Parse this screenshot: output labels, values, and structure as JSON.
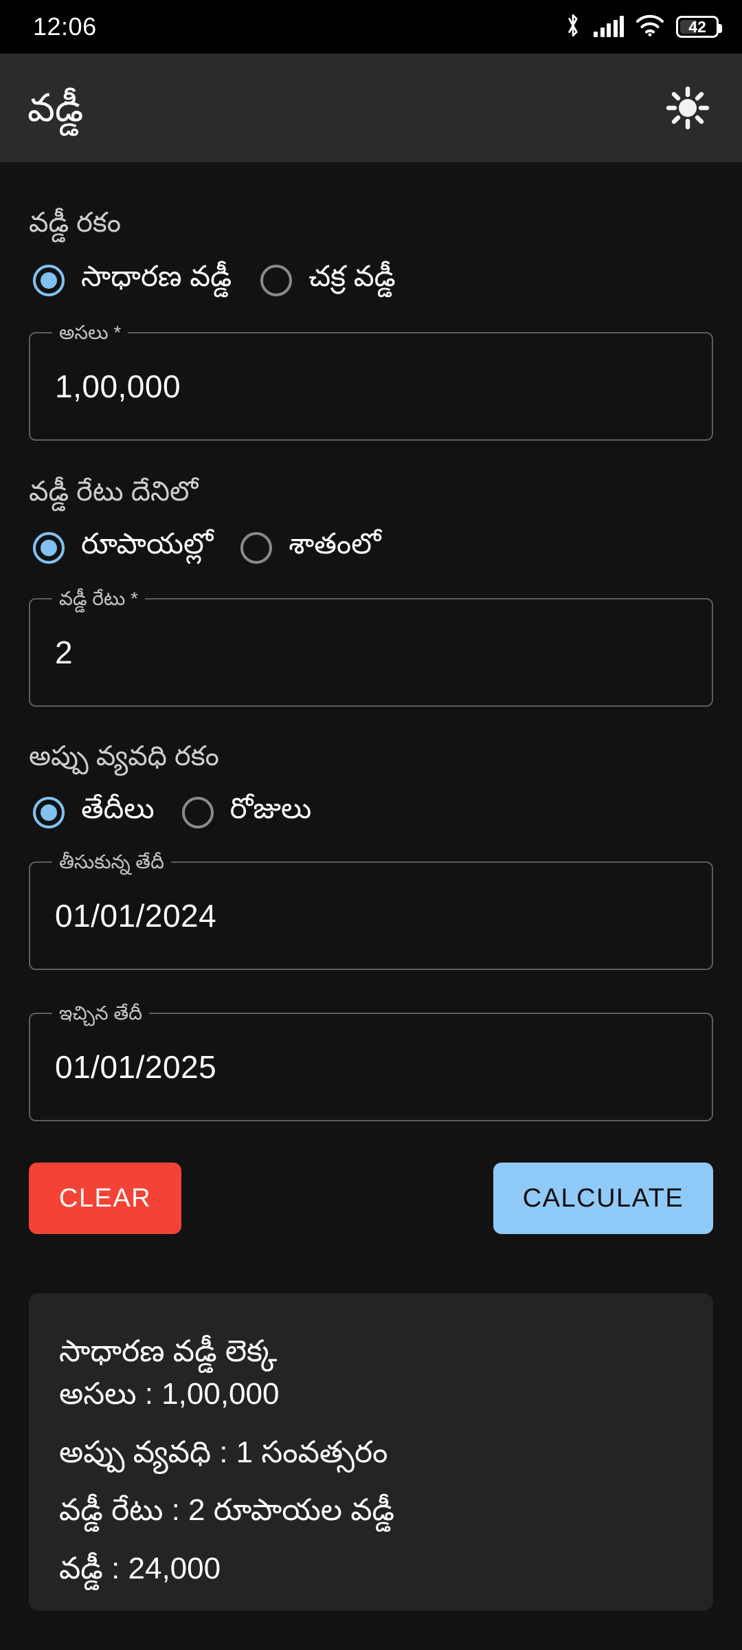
{
  "statusbar": {
    "time": "12:06",
    "battery_percent": "42",
    "icons": [
      "bluetooth-icon",
      "cellular-signal-icon",
      "wifi-icon",
      "battery-icon"
    ]
  },
  "appbar": {
    "title": "వడ్డీ",
    "action_icon": "brightness-sun-icon"
  },
  "interest_type": {
    "label": "వడ్డీ రకం",
    "options": [
      {
        "label": "సాధారణ వడ్డీ",
        "selected": true
      },
      {
        "label": "చక్ర వడ్డీ",
        "selected": false
      }
    ]
  },
  "principal": {
    "label": "అసలు *",
    "value": "1,00,000"
  },
  "rate_unit": {
    "label": "వడ్డీ రేటు దేనిలో",
    "options": [
      {
        "label": "రూపాయల్లో",
        "selected": true
      },
      {
        "label": "శాతంలో",
        "selected": false
      }
    ]
  },
  "rate": {
    "label": "వడ్డీ రేటు *",
    "value": "2"
  },
  "duration_type": {
    "label": "అప్పు వ్యవధి రకం",
    "options": [
      {
        "label": "తేదీలు",
        "selected": true
      },
      {
        "label": "రోజులు",
        "selected": false
      }
    ]
  },
  "from_date": {
    "label": "తీసుకున్న తేదీ",
    "value": "01/01/2024"
  },
  "to_date": {
    "label": "ఇచ్చిన తేదీ",
    "value": "01/01/2025"
  },
  "buttons": {
    "clear": "CLEAR",
    "calculate": "CALCULATE"
  },
  "result": {
    "heading": "సాధారణ వడ్డీ లెక్క",
    "principal_line": "అసలు : 1,00,000",
    "duration_line": "అప్పు వ్యవధి : 1 సంవత్సరం",
    "rate_line": "వడ్డీ రేటు : 2 రూపాయల వడ్డీ",
    "interest_line": "వడ్డీ : 24,000"
  },
  "colors": {
    "page_bg": "#121212",
    "appbar_bg": "#2b2b2b",
    "accent": "#7fc2f2",
    "clear_btn": "#f44336",
    "calc_btn": "#90caf9",
    "card_bg": "#242424"
  }
}
